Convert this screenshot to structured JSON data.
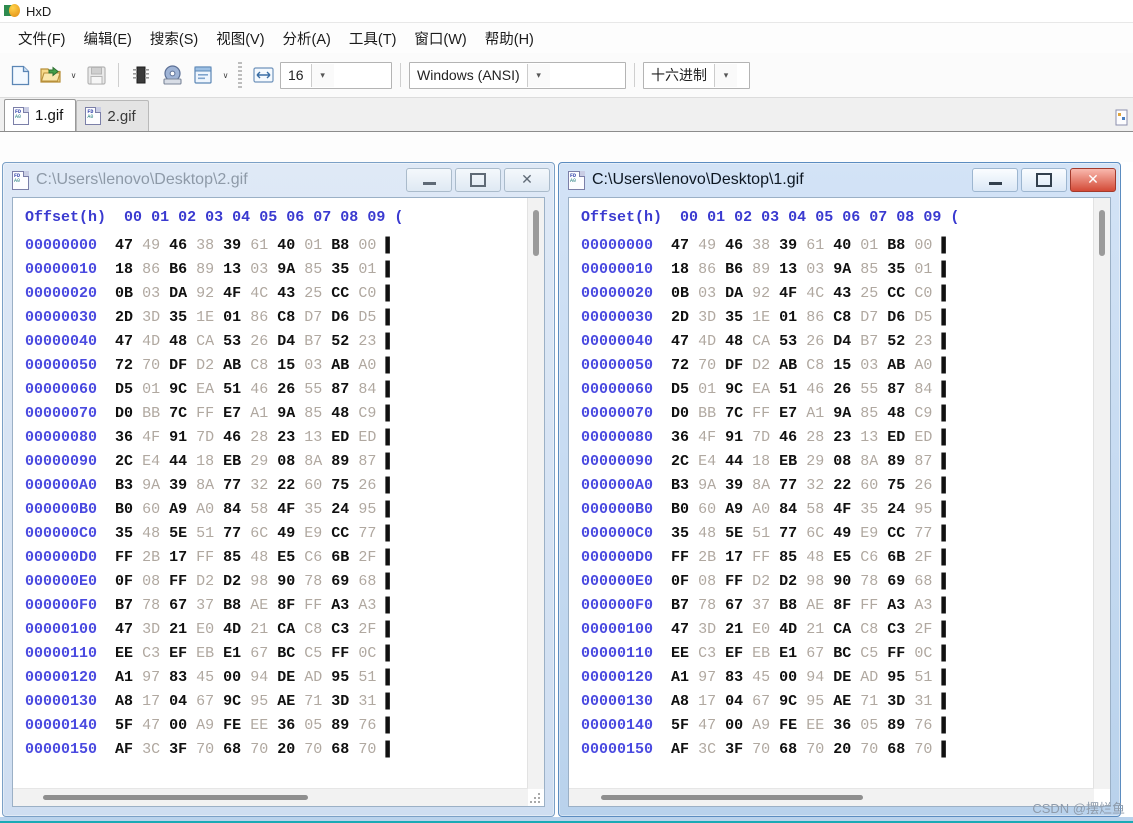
{
  "window": {
    "title": "HxD",
    "app_icon": "hxd-logo-icon"
  },
  "menubar": {
    "items": [
      {
        "label": "文件(F)",
        "name": "menu-file"
      },
      {
        "label": "编辑(E)",
        "name": "menu-edit"
      },
      {
        "label": "搜索(S)",
        "name": "menu-search"
      },
      {
        "label": "视图(V)",
        "name": "menu-view"
      },
      {
        "label": "分析(A)",
        "name": "menu-analysis"
      },
      {
        "label": "工具(T)",
        "name": "menu-tools"
      },
      {
        "label": "窗口(W)",
        "name": "menu-window"
      },
      {
        "label": "帮助(H)",
        "name": "menu-help"
      }
    ]
  },
  "toolbar": {
    "bytes_per_row": "16",
    "encoding": "Windows (ANSI)",
    "number_base": "十六进制",
    "caret": "∨"
  },
  "tabs": [
    {
      "label": "1.gif",
      "active": true
    },
    {
      "label": "2.gif",
      "active": false
    }
  ],
  "left_window": {
    "title": "C:\\Users\\lenovo\\Desktop\\2.gif",
    "active": false,
    "minimize_label": "",
    "maximize_label": "",
    "close_label": "✕"
  },
  "right_window": {
    "title": "C:\\Users\\lenovo\\Desktop\\1.gif",
    "active": true,
    "minimize_label": "",
    "maximize_label": "",
    "close_label": "✕"
  },
  "hex_view": {
    "offset_header": "Offset(h)",
    "columns": [
      "00",
      "01",
      "02",
      "03",
      "04",
      "05",
      "06",
      "07",
      "08",
      "09"
    ],
    "rows": [
      {
        "offset": "00000000",
        "bytes": [
          "47",
          "49",
          "46",
          "38",
          "39",
          "61",
          "40",
          "01",
          "B8",
          "00"
        ]
      },
      {
        "offset": "00000010",
        "bytes": [
          "18",
          "86",
          "B6",
          "89",
          "13",
          "03",
          "9A",
          "85",
          "35",
          "01"
        ]
      },
      {
        "offset": "00000020",
        "bytes": [
          "0B",
          "03",
          "DA",
          "92",
          "4F",
          "4C",
          "43",
          "25",
          "CC",
          "C0"
        ]
      },
      {
        "offset": "00000030",
        "bytes": [
          "2D",
          "3D",
          "35",
          "1E",
          "01",
          "86",
          "C8",
          "D7",
          "D6",
          "D5"
        ]
      },
      {
        "offset": "00000040",
        "bytes": [
          "47",
          "4D",
          "48",
          "CA",
          "53",
          "26",
          "D4",
          "B7",
          "52",
          "23"
        ]
      },
      {
        "offset": "00000050",
        "bytes": [
          "72",
          "70",
          "DF",
          "D2",
          "AB",
          "C8",
          "15",
          "03",
          "AB",
          "A0"
        ]
      },
      {
        "offset": "00000060",
        "bytes": [
          "D5",
          "01",
          "9C",
          "EA",
          "51",
          "46",
          "26",
          "55",
          "87",
          "84"
        ]
      },
      {
        "offset": "00000070",
        "bytes": [
          "D0",
          "BB",
          "7C",
          "FF",
          "E7",
          "A1",
          "9A",
          "85",
          "48",
          "C9"
        ]
      },
      {
        "offset": "00000080",
        "bytes": [
          "36",
          "4F",
          "91",
          "7D",
          "46",
          "28",
          "23",
          "13",
          "ED",
          "ED"
        ]
      },
      {
        "offset": "00000090",
        "bytes": [
          "2C",
          "E4",
          "44",
          "18",
          "EB",
          "29",
          "08",
          "8A",
          "89",
          "87"
        ]
      },
      {
        "offset": "000000A0",
        "bytes": [
          "B3",
          "9A",
          "39",
          "8A",
          "77",
          "32",
          "22",
          "60",
          "75",
          "26"
        ]
      },
      {
        "offset": "000000B0",
        "bytes": [
          "B0",
          "60",
          "A9",
          "A0",
          "84",
          "58",
          "4F",
          "35",
          "24",
          "95"
        ]
      },
      {
        "offset": "000000C0",
        "bytes": [
          "35",
          "48",
          "5E",
          "51",
          "77",
          "6C",
          "49",
          "E9",
          "CC",
          "77"
        ]
      },
      {
        "offset": "000000D0",
        "bytes": [
          "FF",
          "2B",
          "17",
          "FF",
          "85",
          "48",
          "E5",
          "C6",
          "6B",
          "2F"
        ]
      },
      {
        "offset": "000000E0",
        "bytes": [
          "0F",
          "08",
          "FF",
          "D2",
          "D2",
          "98",
          "90",
          "78",
          "69",
          "68"
        ]
      },
      {
        "offset": "000000F0",
        "bytes": [
          "B7",
          "78",
          "67",
          "37",
          "B8",
          "AE",
          "8F",
          "FF",
          "A3",
          "A3"
        ]
      },
      {
        "offset": "00000100",
        "bytes": [
          "47",
          "3D",
          "21",
          "E0",
          "4D",
          "21",
          "CA",
          "C8",
          "C3",
          "2F"
        ]
      },
      {
        "offset": "00000110",
        "bytes": [
          "EE",
          "C3",
          "EF",
          "EB",
          "E1",
          "67",
          "BC",
          "C5",
          "FF",
          "0C"
        ]
      },
      {
        "offset": "00000120",
        "bytes": [
          "A1",
          "97",
          "83",
          "45",
          "00",
          "94",
          "DE",
          "AD",
          "95",
          "51"
        ]
      },
      {
        "offset": "00000130",
        "bytes": [
          "A8",
          "17",
          "04",
          "67",
          "9C",
          "95",
          "AE",
          "71",
          "3D",
          "31"
        ]
      },
      {
        "offset": "00000140",
        "bytes": [
          "5F",
          "47",
          "00",
          "A9",
          "FE",
          "EE",
          "36",
          "05",
          "89",
          "76"
        ]
      },
      {
        "offset": "00000150",
        "bytes": [
          "AF",
          "3C",
          "3F",
          "70",
          "68",
          "70",
          "20",
          "70",
          "68",
          "70"
        ]
      }
    ]
  },
  "watermark": {
    "text": "CSDN @摆烂鱼"
  },
  "colors": {
    "offset_blue": "#4a4ae0",
    "header_blue": "#3a3ad0",
    "byte_dark": "#111111",
    "byte_light": "#b0a8a0",
    "active_window_chrome": "#b9d2ec",
    "inactive_window_chrome": "#cfdef1",
    "close_red": "#d34a37"
  }
}
